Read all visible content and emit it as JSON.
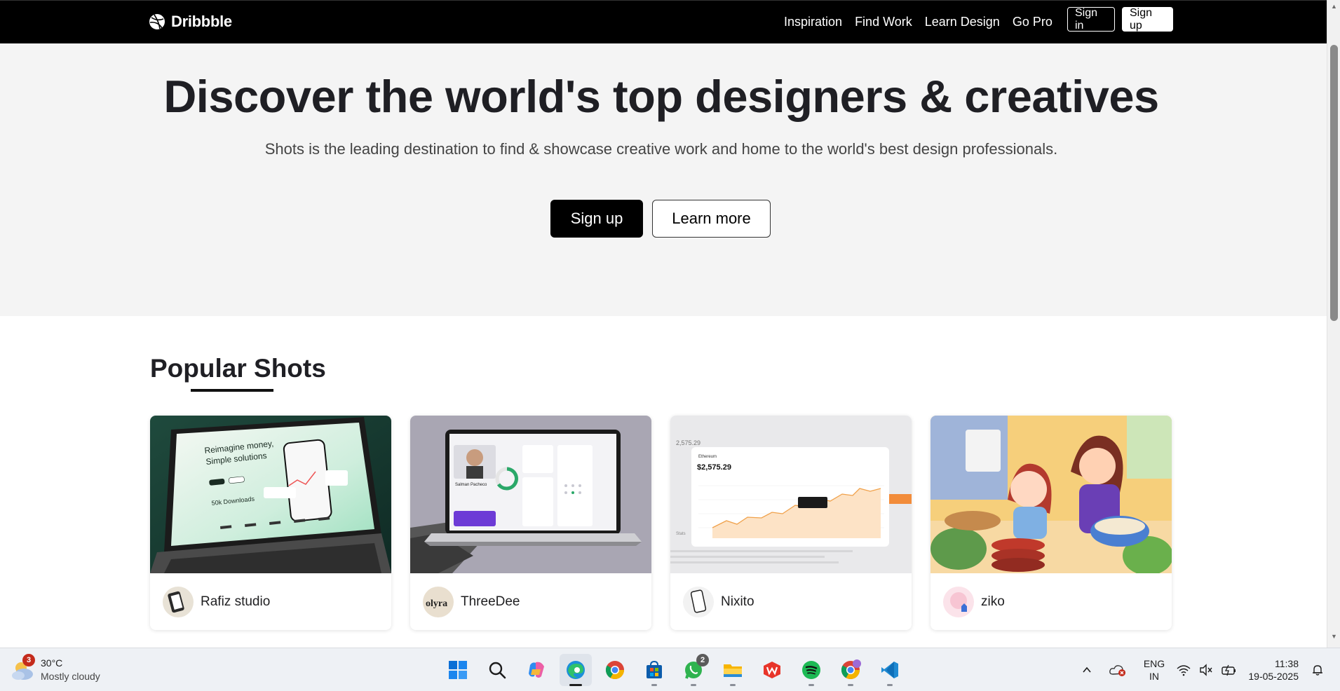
{
  "browser": {
    "navbar": {
      "logo_text": "Dribbble",
      "links": [
        "Inspiration",
        "Find Work",
        "Learn Design",
        "Go Pro"
      ],
      "sign_in": "Sign in",
      "sign_up": "Sign up"
    },
    "hero": {
      "title": "Discover the world's top designers & creatives",
      "subtitle": "Shots is the leading destination to find & showcase creative work and home to the world's best design professionals.",
      "signup_button": "Sign up",
      "learn_more_button": "Learn more"
    },
    "popular": {
      "title": "Popular Shots",
      "shots": [
        {
          "author": "Rafiz studio",
          "thumb_icon": "fintech-laptop-image"
        },
        {
          "author": "ThreeDee",
          "thumb_icon": "dashboard-laptop-image"
        },
        {
          "author": "Nixito",
          "thumb_icon": "crypto-chart-image"
        },
        {
          "author": "ziko",
          "thumb_icon": "cooking-illustration-image"
        }
      ],
      "shot_texts": {
        "rafiz_headline_1": "Reimagine money,",
        "rafiz_headline_2": "Simple solutions",
        "rafiz_downloads": "50k Downloads",
        "threedee_name": "Salman Pacheco",
        "nixito_asset": "Ethereum",
        "nixito_price": "$2,575.29",
        "nixito_bg_price": "2,575.29",
        "threedee_avatar_text": "olyra"
      }
    },
    "colors": {
      "navbar_bg": "#000000",
      "hero_bg": "#f4f4f4",
      "accent_black": "#000000"
    }
  },
  "taskbar": {
    "weather": {
      "temp": "30°C",
      "condition": "Mostly cloudy",
      "badge": "3"
    },
    "apps": [
      {
        "name": "windows-start-icon"
      },
      {
        "name": "search-icon"
      },
      {
        "name": "copilot-icon"
      },
      {
        "name": "edge-icon",
        "active": true
      },
      {
        "name": "chrome-icon"
      },
      {
        "name": "microsoft-store-icon"
      },
      {
        "name": "whatsapp-icon",
        "badge": "2"
      },
      {
        "name": "file-explorer-icon"
      },
      {
        "name": "wps-office-icon"
      },
      {
        "name": "spotify-icon"
      },
      {
        "name": "chrome-profile-icon"
      },
      {
        "name": "vscode-icon"
      }
    ],
    "tray": {
      "language_1": "ENG",
      "language_2": "IN",
      "time": "11:38",
      "date": "19-05-2025"
    }
  }
}
